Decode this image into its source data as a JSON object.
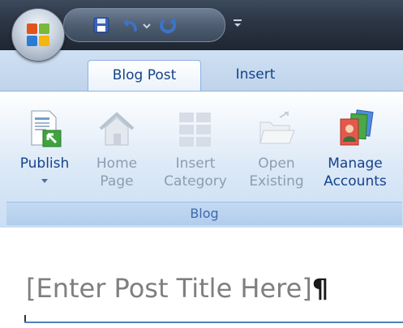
{
  "tabs": [
    {
      "label": "Blog Post",
      "active": true
    },
    {
      "label": "Insert",
      "active": false
    }
  ],
  "ribbon": {
    "group_label": "Blog",
    "buttons": [
      {
        "line1": "Publish",
        "line2": "",
        "enabled": true,
        "has_dropdown": true,
        "icon": "publish-icon"
      },
      {
        "line1": "Home",
        "line2": "Page",
        "enabled": false,
        "icon": "home-icon"
      },
      {
        "line1": "Insert",
        "line2": "Category",
        "enabled": false,
        "icon": "category-icon"
      },
      {
        "line1": "Open",
        "line2": "Existing",
        "enabled": false,
        "icon": "folder-open-icon"
      },
      {
        "line1": "Manage",
        "line2": "Accounts",
        "enabled": true,
        "icon": "accounts-icon"
      }
    ]
  },
  "quick_access_toolbar": {
    "icons": [
      "save-icon",
      "undo-icon",
      "undo-dropdown-icon",
      "redo-icon",
      "customize-qat-icon"
    ]
  },
  "document": {
    "title_placeholder": "[Enter Post Title Here]",
    "pilcrow": "¶"
  },
  "colors": {
    "tab_text": "#15428b",
    "disabled_text": "#8d9cb0",
    "title_text": "#7f7f7f",
    "title_rule": "#4f81bd"
  }
}
